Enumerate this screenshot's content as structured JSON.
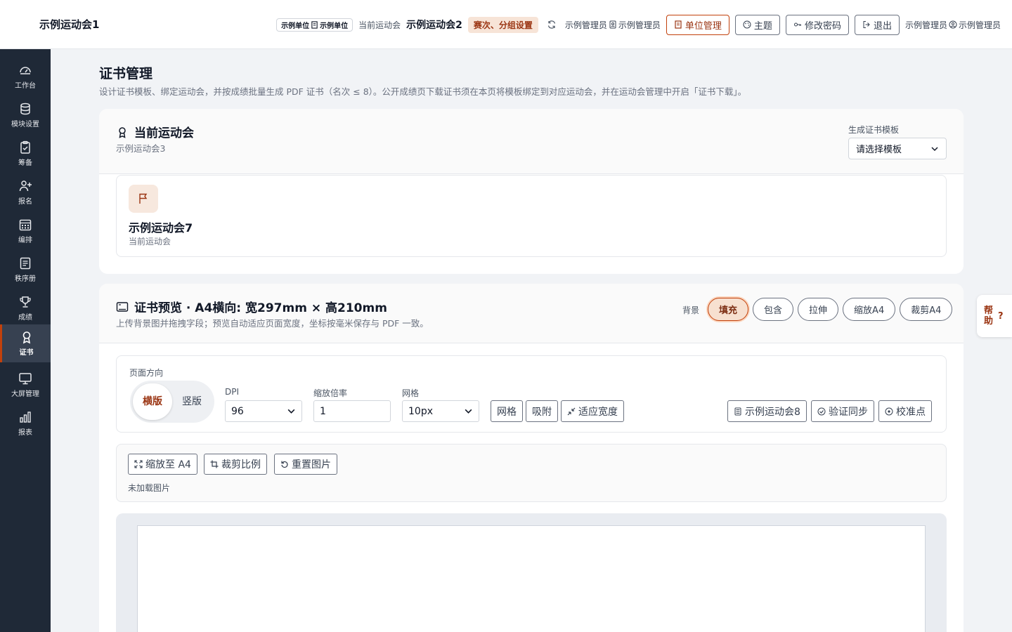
{
  "app": {
    "title": "示例运动会1"
  },
  "header": {
    "unit_chip": {
      "left": "示例单位",
      "right": "示例单位"
    },
    "current_label": "当前运动会",
    "current_value": "示例运动会2",
    "event_badge": "赛次、分组设置",
    "admin_1": "示例管理员",
    "admin_2": "示例管理员",
    "unit_btn": "单位管理",
    "theme_btn": "主题",
    "password_btn": "修改密码",
    "logout_btn": "退出",
    "admin_3": "示例管理员",
    "admin_4": "示例管理员"
  },
  "sidebar": {
    "items": [
      {
        "label": "工作台",
        "icon": "dashboard-icon"
      },
      {
        "label": "模块设置",
        "icon": "database-icon"
      },
      {
        "label": "筹备",
        "icon": "clipboard-icon"
      },
      {
        "label": "报名",
        "icon": "user-plus-icon"
      },
      {
        "label": "编排",
        "icon": "calendar-icon"
      },
      {
        "label": "秩序册",
        "icon": "list-icon"
      },
      {
        "label": "成绩",
        "icon": "trophy-icon"
      },
      {
        "label": "证书",
        "icon": "award-icon",
        "active": true
      },
      {
        "label": "大屏管理",
        "icon": "monitor-icon"
      },
      {
        "label": "报表",
        "icon": "bar-chart-icon"
      }
    ]
  },
  "page": {
    "title": "证书管理",
    "description": "设计证书模板、绑定运动会，并按成绩批量生成 PDF 证书（名次 ≤ 8）。公开成绩页下载证书须在本页将模板绑定到对应运动会，并在运动会管理中开启「证书下载」。"
  },
  "current_event_card": {
    "title": "当前运动会",
    "subtitle": "示例运动会3",
    "template_label": "生成证书模板",
    "template_select": "请选择模板",
    "event_name": "示例运动会7",
    "event_sub": "当前运动会"
  },
  "preview_card": {
    "title": "证书预览 · A4横向: 宽297mm × 高210mm",
    "subtitle": "上传背景图并拖拽字段；预览自动适应页面宽度，坐标按毫米保存与 PDF 一致。",
    "background_label": "背景",
    "background_options": [
      "填充",
      "包含",
      "拉伸",
      "缩放A4",
      "裁剪A4"
    ],
    "background_selected": "填充",
    "orientation_label": "页面方向",
    "orientation_options": [
      "横版",
      "竖版"
    ],
    "orientation_selected": "横版",
    "dpi_label": "DPI",
    "dpi_value": "96",
    "zoom_label": "缩放倍率",
    "zoom_value": "1",
    "grid_label": "网格",
    "grid_value": "10px",
    "grid_btn": "网格",
    "snap_btn": "吸附",
    "fit_width_btn": "适应宽度",
    "event_btn": "示例运动会8",
    "verify_btn": "验证同步",
    "calibrate_btn": "校准点",
    "scale_a4_btn": "缩放至 A4",
    "crop_ratio_btn": "裁剪比例",
    "reset_img_btn": "重置图片",
    "no_image_text": "未加载图片"
  },
  "help": {
    "label": "帮助",
    "symbol": "?"
  },
  "colors": {
    "accent": "#c2410c",
    "sidebar_bg": "#1f2937",
    "badge_bg": "#f7e4d7"
  }
}
